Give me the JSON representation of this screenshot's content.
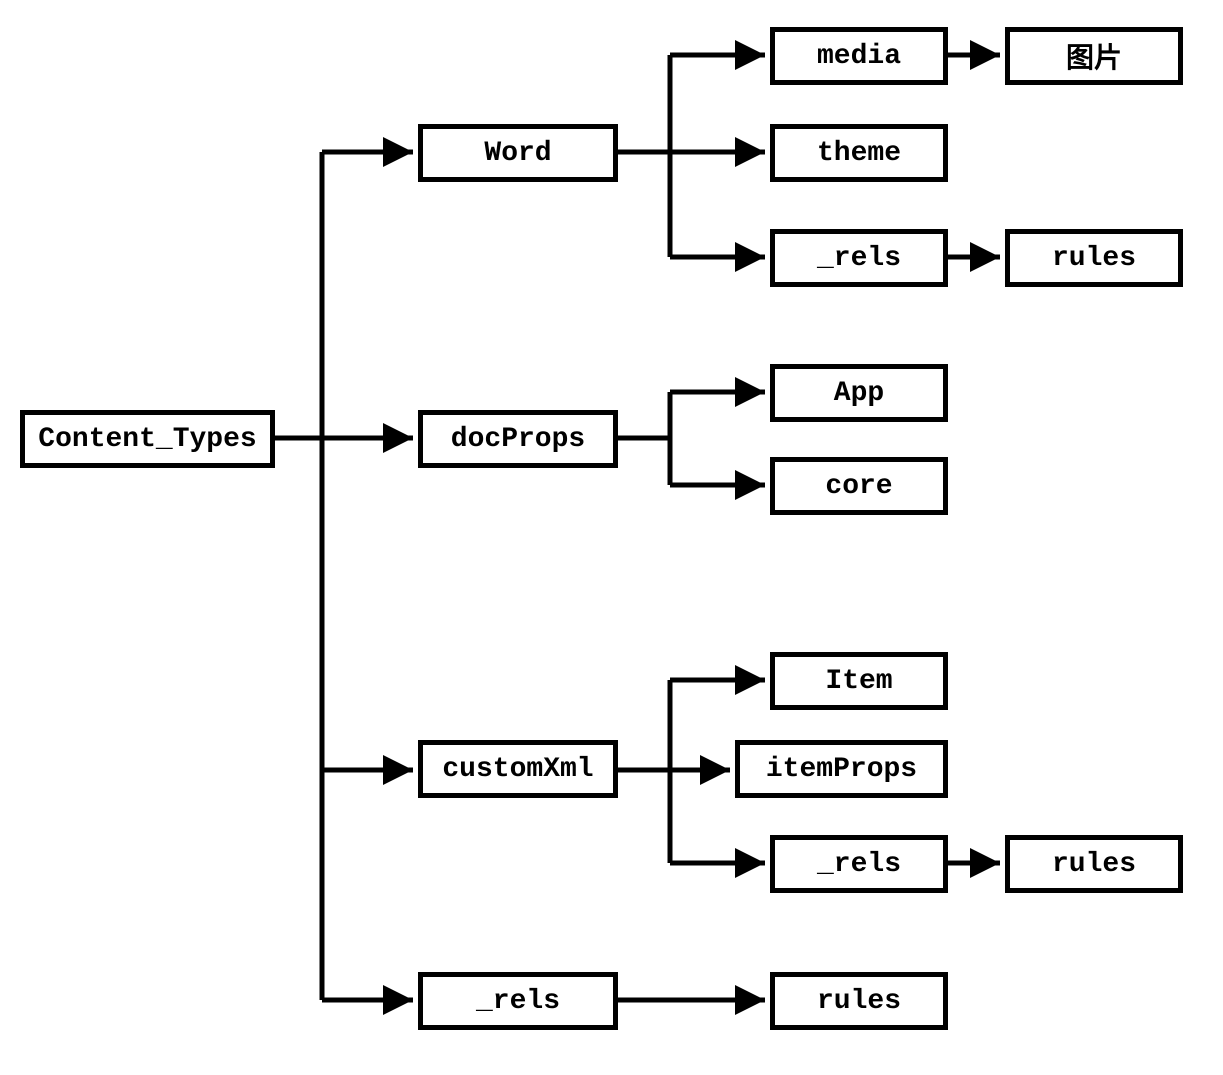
{
  "root": {
    "label": "Content_Types"
  },
  "level1": {
    "word": {
      "label": "Word"
    },
    "docprops": {
      "label": "docProps"
    },
    "customxml": {
      "label": "customXml"
    },
    "rels": {
      "label": "_rels"
    }
  },
  "level2": {
    "media": {
      "label": "media"
    },
    "theme": {
      "label": "theme"
    },
    "wordrels": {
      "label": "_rels"
    },
    "app": {
      "label": "App"
    },
    "core": {
      "label": "core"
    },
    "item": {
      "label": "Item"
    },
    "itemprops": {
      "label": "itemProps"
    },
    "custrels": {
      "label": "_rels"
    },
    "rules": {
      "label": "rules"
    }
  },
  "level3": {
    "image": {
      "label": "图片"
    },
    "wordrules": {
      "label": "rules"
    },
    "custrules": {
      "label": "rules"
    }
  }
}
